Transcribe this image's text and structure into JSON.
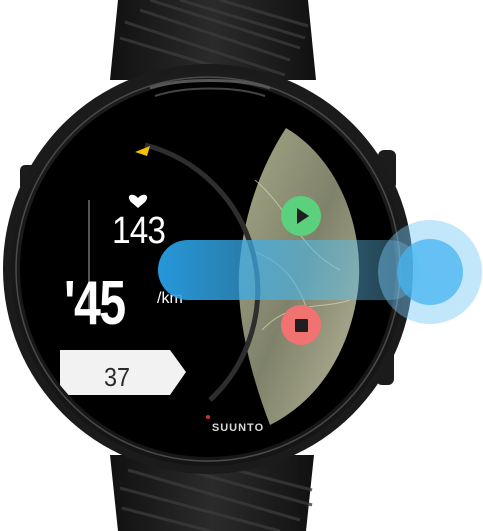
{
  "watch": {
    "brand": "SUUNTO",
    "heart_rate": {
      "icon": "heart-icon",
      "value": "143"
    },
    "pace": {
      "value": "'45",
      "unit": "/km"
    },
    "partial_field": {
      "value": "37"
    },
    "actions": [
      {
        "name": "resume-button",
        "icon": "play-icon",
        "color": "#5bd07d"
      },
      {
        "name": "stop-button",
        "icon": "stop-icon",
        "color": "#f07371"
      }
    ],
    "gesture": {
      "type": "swipe-left",
      "indicator": "touch-point-icon",
      "color": "#3aa9e8"
    },
    "colors": {
      "strap": "#1a1a1a",
      "screen": "#000000",
      "accent_marker": "#f2c200",
      "map_panel": "#8a8c70"
    }
  }
}
